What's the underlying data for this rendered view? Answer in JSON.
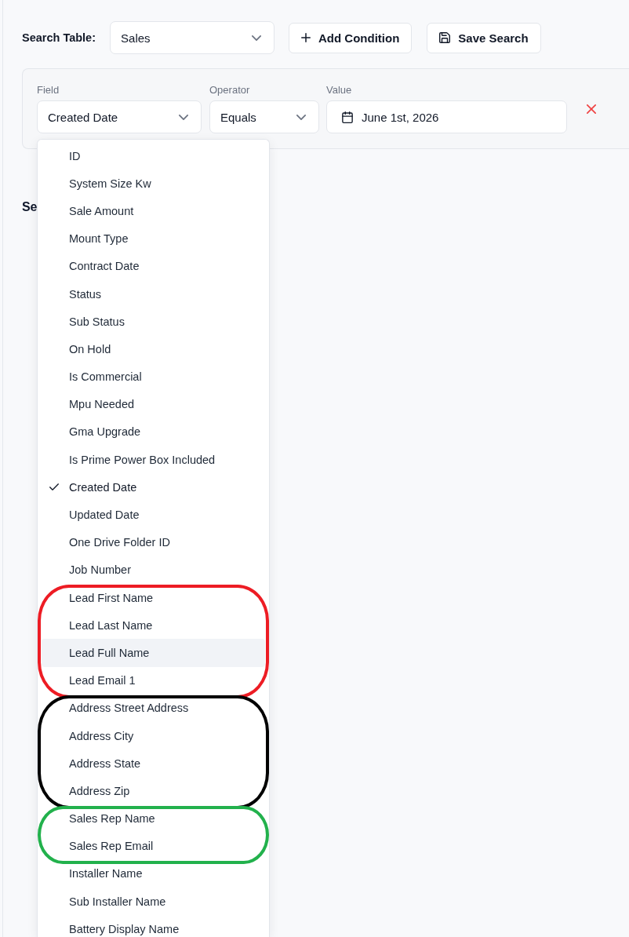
{
  "toolbar": {
    "label": "Search Table:",
    "table_select": {
      "value": "Sales"
    },
    "buttons": [
      {
        "kind": "add",
        "label": "Add Condition"
      },
      {
        "kind": "save",
        "label": "Save Search"
      }
    ]
  },
  "condition": {
    "field": {
      "label": "Field",
      "value": "Created Date",
      "expanded": true
    },
    "operator": {
      "label": "Operator",
      "value": "Equals"
    },
    "value": {
      "label": "Value",
      "value": "June 1st, 2026"
    }
  },
  "section": {
    "heading": "Se"
  },
  "field_menu": {
    "groups": [
      {
        "options": [
          {
            "label": "ID",
            "selected": false,
            "highlighted": false
          },
          {
            "label": "System Size Kw",
            "selected": false,
            "highlighted": false
          },
          {
            "label": "Sale Amount",
            "selected": false,
            "highlighted": false
          },
          {
            "label": "Mount Type",
            "selected": false,
            "highlighted": false
          },
          {
            "label": "Contract Date",
            "selected": false,
            "highlighted": false
          },
          {
            "label": "Status",
            "selected": false,
            "highlighted": false
          },
          {
            "label": "Sub Status",
            "selected": false,
            "highlighted": false
          },
          {
            "label": "On Hold",
            "selected": false,
            "highlighted": false
          },
          {
            "label": "Is Commercial",
            "selected": false,
            "highlighted": false
          },
          {
            "label": "Mpu Needed",
            "selected": false,
            "highlighted": false
          },
          {
            "label": "Gma Upgrade",
            "selected": false,
            "highlighted": false
          },
          {
            "label": "Is Prime Power Box Included",
            "selected": false,
            "highlighted": false
          },
          {
            "label": "Created Date",
            "selected": true,
            "highlighted": false
          },
          {
            "label": "Updated Date",
            "selected": false,
            "highlighted": false
          },
          {
            "label": "One Drive Folder ID",
            "selected": false,
            "highlighted": false
          },
          {
            "label": "Job Number",
            "selected": false,
            "highlighted": false
          }
        ]
      },
      {
        "color": "#ed1c24",
        "options": [
          {
            "label": "Lead First Name",
            "selected": false,
            "highlighted": false
          },
          {
            "label": "Lead Last Name",
            "selected": false,
            "highlighted": false
          },
          {
            "label": "Lead Full Name",
            "selected": false,
            "highlighted": true
          },
          {
            "label": "Lead Email 1",
            "selected": false,
            "highlighted": false
          }
        ]
      },
      {
        "color": "#000000",
        "options": [
          {
            "label": "Address Street Address",
            "selected": false,
            "highlighted": false
          },
          {
            "label": "Address City",
            "selected": false,
            "highlighted": false
          },
          {
            "label": "Address State",
            "selected": false,
            "highlighted": false
          },
          {
            "label": "Address Zip",
            "selected": false,
            "highlighted": false
          }
        ]
      },
      {
        "color": "#22b14c",
        "options": [
          {
            "label": "Sales Rep Name",
            "selected": false,
            "highlighted": false
          },
          {
            "label": "Sales Rep Email",
            "selected": false,
            "highlighted": false
          }
        ]
      },
      {
        "options": [
          {
            "label": "Installer Name",
            "selected": false,
            "highlighted": false
          },
          {
            "label": "Sub Installer Name",
            "selected": false,
            "highlighted": false
          },
          {
            "label": "Battery Display Name",
            "selected": false,
            "highlighted": false
          }
        ]
      }
    ]
  }
}
